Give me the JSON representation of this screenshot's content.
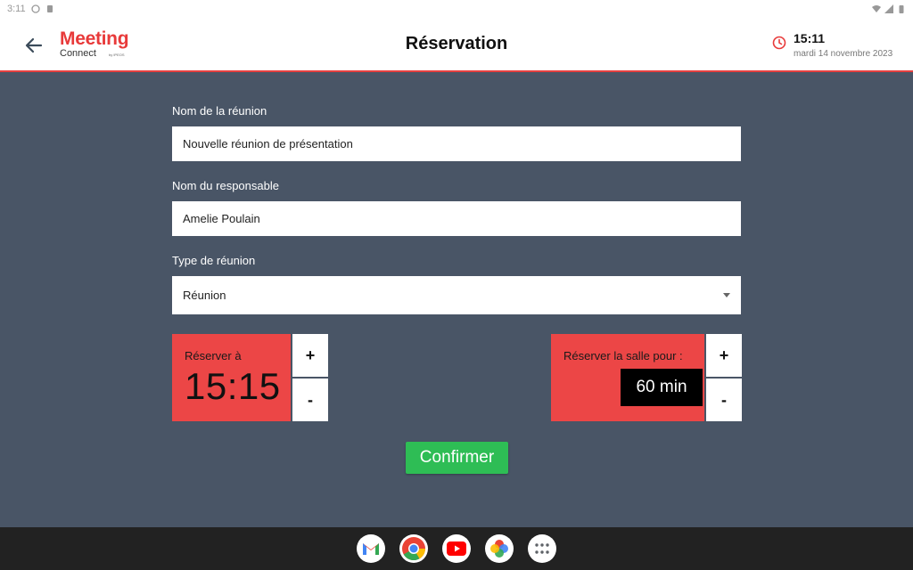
{
  "status_bar": {
    "time": "3:11"
  },
  "header": {
    "logo_main": "Meeting",
    "logo_sub": "Connect",
    "logo_by": "by IPEOS",
    "title": "Réservation",
    "clock_time": "15:11",
    "clock_date": "mardi 14 novembre 2023"
  },
  "form": {
    "meeting_name": {
      "label": "Nom de la réunion",
      "value": "Nouvelle réunion de présentation"
    },
    "organizer_name": {
      "label": "Nom du responsable",
      "value": "Amelie Poulain"
    },
    "meeting_type": {
      "label": "Type de réunion",
      "value": "Réunion"
    }
  },
  "booking": {
    "start_label": "Réserver à",
    "start_time": "15:15",
    "duration_label": "Réserver la salle pour :",
    "duration_value": "60 min",
    "plus": "+",
    "minus": "-"
  },
  "confirm_label": "Confirmer",
  "dock": [
    "gmail-icon",
    "chrome-icon",
    "youtube-icon",
    "photos-icon",
    "apps-icon"
  ],
  "colors": {
    "accent_red": "#ec4646",
    "background": "#495566",
    "confirm_green": "#2ebd55"
  }
}
